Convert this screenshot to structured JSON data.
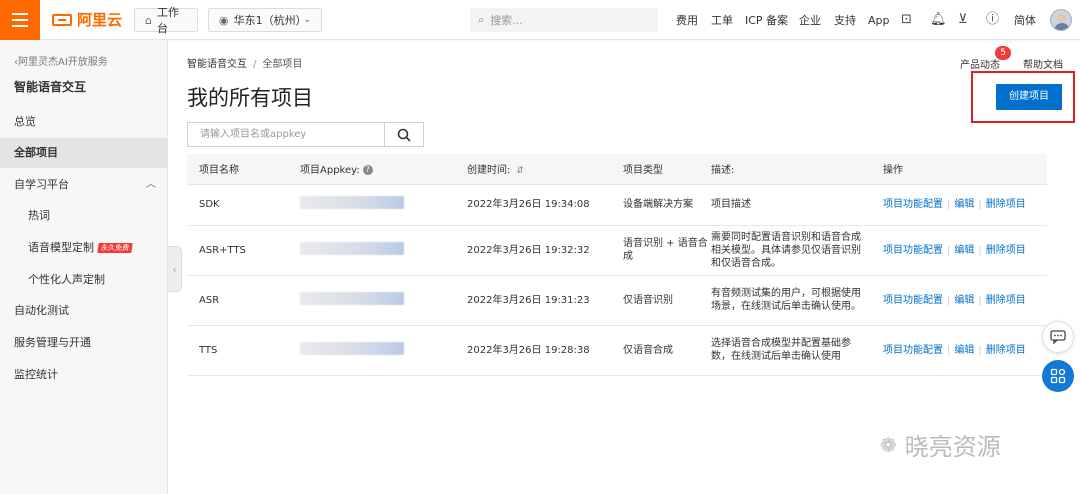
{
  "header": {
    "brand": "阿里云",
    "workbench": "工作台",
    "region": "华东1（杭州）",
    "search_placeholder": "搜索...",
    "nav": [
      "费用",
      "工单",
      "ICP 备案",
      "企业",
      "支持",
      "App"
    ],
    "lang": "简体",
    "accent": "#ff6a00"
  },
  "sidebar": {
    "back_link": "阿里灵杰AI开放服务",
    "title": "智能语音交互",
    "items": [
      {
        "label": "总览"
      },
      {
        "label": "全部项目",
        "active": true
      },
      {
        "label": "自学习平台"
      },
      {
        "label": "热词"
      },
      {
        "label": "语音模型定制",
        "badge": "永久免费"
      },
      {
        "label": "个性化人声定制"
      },
      {
        "label": "自动化测试"
      },
      {
        "label": "服务管理与开通"
      },
      {
        "label": "监控统计"
      }
    ]
  },
  "breadcrumb": {
    "root": "智能语音交互",
    "current": "全部项目"
  },
  "main": {
    "title": "我的所有项目",
    "product_news": "产品动态",
    "news_count": "5",
    "help_doc": "帮助文档",
    "create_button": "创建项目",
    "search_placeholder": "请输入项目名或appkey"
  },
  "table": {
    "headers": [
      "项目名称",
      "项目Appkey:",
      "创建时间:",
      "项目类型",
      "描述:",
      "操作"
    ],
    "rows": [
      {
        "name": "SDK",
        "time": "2022年3月26日 19:34:08",
        "type": "设备端解决方案",
        "desc": "项目描述"
      },
      {
        "name": "ASR+TTS",
        "time": "2022年3月26日 19:32:32",
        "type": "语音识别 + 语音合成",
        "desc": "需要同时配置语音识别和语音合成相关模型。具体请参见仅语音识别和仅语音合成。"
      },
      {
        "name": "ASR",
        "time": "2022年3月26日 19:31:23",
        "type": "仅语音识别",
        "desc": "有音频测试集的用户，可根据使用场景，在线测试后单击确认使用。"
      },
      {
        "name": "TTS",
        "time": "2022年3月26日 19:28:38",
        "type": "仅语音合成",
        "desc": "选择语音合成模型并配置基础参数，在线测试后单击确认使用"
      }
    ],
    "actions": [
      "项目功能配置",
      "编辑",
      "删除项目"
    ]
  },
  "watermark": "晓亮资源"
}
